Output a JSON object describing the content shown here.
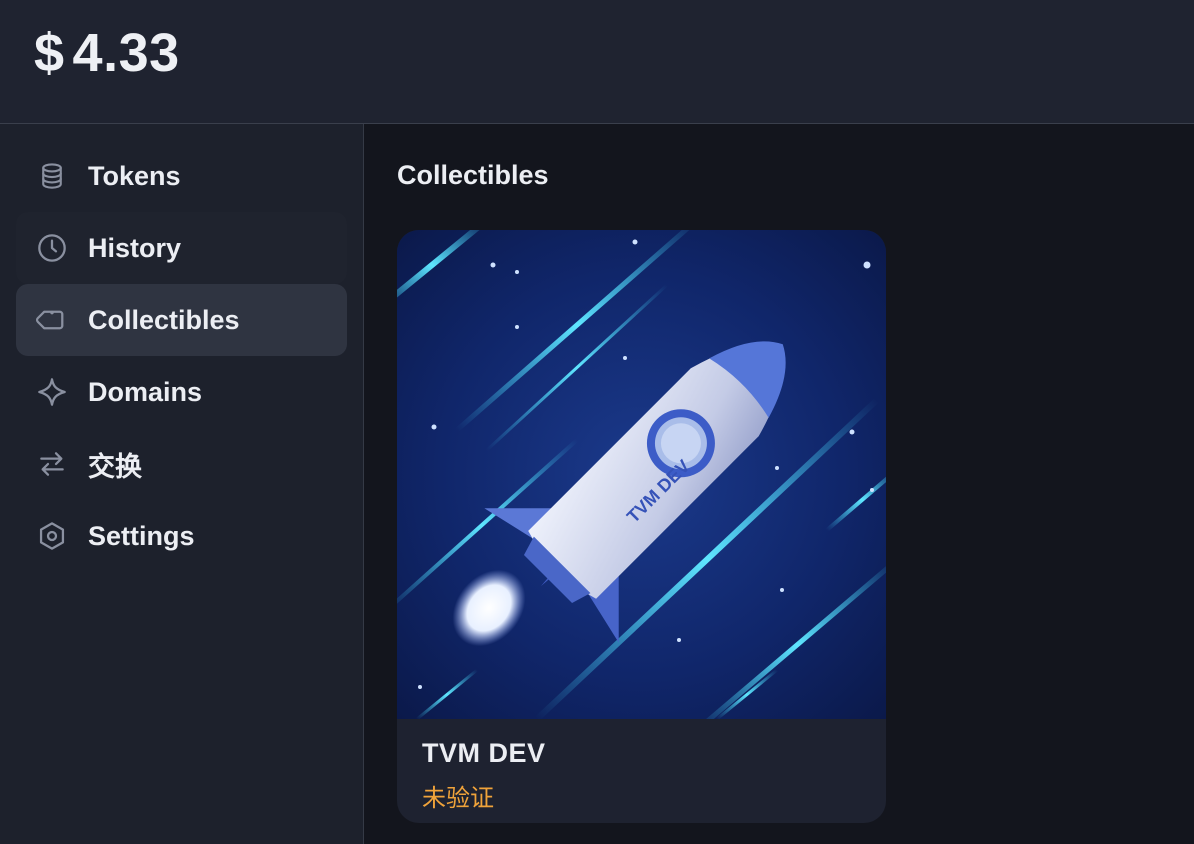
{
  "header": {
    "currency_symbol": "$",
    "balance": "4.33"
  },
  "sidebar": {
    "items": [
      {
        "label": "Tokens",
        "icon": "database-icon"
      },
      {
        "label": "History",
        "icon": "clock-icon"
      },
      {
        "label": "Collectibles",
        "icon": "tag-icon",
        "active": true
      },
      {
        "label": "Domains",
        "icon": "sparkle-icon"
      },
      {
        "label": "交换",
        "icon": "swap-arrows-icon"
      },
      {
        "label": "Settings",
        "icon": "hexagon-gear-icon"
      }
    ]
  },
  "main": {
    "title": "Collectibles",
    "collectibles": [
      {
        "name": "TVM DEV",
        "status": "未验证",
        "image_icon": "rocket-illustration",
        "image_text": "TVM DEV"
      }
    ]
  },
  "colors": {
    "background": "#13151d",
    "header": "#1f2330",
    "sidebar": "#1d212c",
    "active_item": "#2f3441",
    "status_warning": "#f0a33a"
  }
}
